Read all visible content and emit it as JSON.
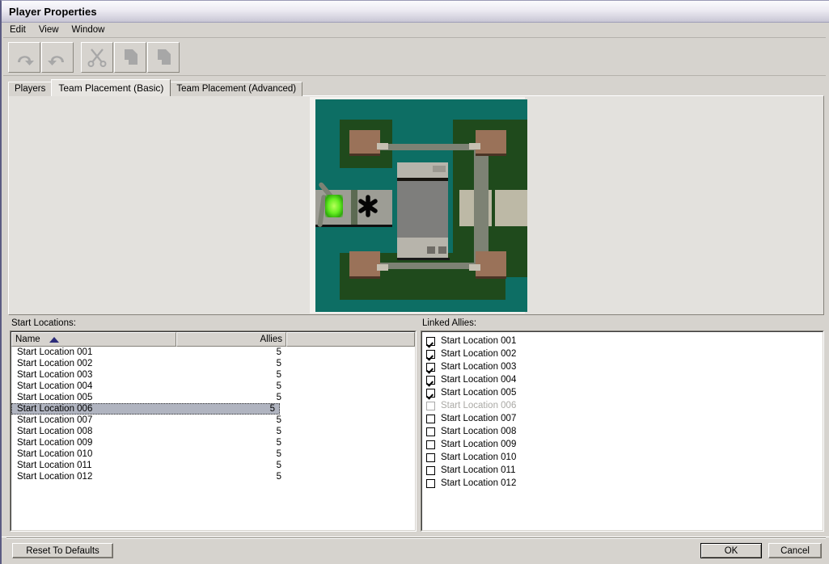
{
  "window": {
    "title": "Player Properties"
  },
  "menubar": {
    "items": [
      {
        "label": "Edit"
      },
      {
        "label": "View"
      },
      {
        "label": "Window"
      }
    ]
  },
  "toolbar": {
    "buttons": [
      {
        "name": "undo-button",
        "icon": "undo-icon",
        "label": "Undo"
      },
      {
        "name": "redo-button",
        "icon": "redo-icon",
        "label": "Redo"
      },
      {
        "name": "cut-button",
        "icon": "scissors-icon",
        "label": "Cut"
      },
      {
        "name": "copy-button",
        "icon": "copy-icon",
        "label": "Copy"
      },
      {
        "name": "paste-button",
        "icon": "paste-icon",
        "label": "Paste"
      }
    ]
  },
  "tabs": [
    {
      "label": "Players",
      "active": false
    },
    {
      "label": "Team Placement (Basic)",
      "active": true
    },
    {
      "label": "Team Placement (Advanced)",
      "active": false
    }
  ],
  "map_preview": {
    "background_color": "#0d6e64",
    "terrain_color": "#1f4a1c",
    "road_color": "#7d8274",
    "building_color": "#9a7259",
    "structure_color": "#7e7e7c",
    "concrete_color": "#9d9d95",
    "marker_color": "#66ee22"
  },
  "start_locations_panel": {
    "caption": "Start Locations:",
    "columns": [
      {
        "key": "name",
        "label": "Name",
        "sort": "asc"
      },
      {
        "key": "allies",
        "label": "Allies",
        "sort": "none"
      }
    ],
    "rows": [
      {
        "name": "Start Location 001",
        "allies": "5",
        "selected": false
      },
      {
        "name": "Start Location 002",
        "allies": "5",
        "selected": false
      },
      {
        "name": "Start Location 003",
        "allies": "5",
        "selected": false
      },
      {
        "name": "Start Location 004",
        "allies": "5",
        "selected": false
      },
      {
        "name": "Start Location 005",
        "allies": "5",
        "selected": false
      },
      {
        "name": "Start Location 006",
        "allies": "5",
        "selected": true
      },
      {
        "name": "Start Location 007",
        "allies": "5",
        "selected": false
      },
      {
        "name": "Start Location 008",
        "allies": "5",
        "selected": false
      },
      {
        "name": "Start Location 009",
        "allies": "5",
        "selected": false
      },
      {
        "name": "Start Location 010",
        "allies": "5",
        "selected": false
      },
      {
        "name": "Start Location 011",
        "allies": "5",
        "selected": false
      },
      {
        "name": "Start Location 012",
        "allies": "5",
        "selected": false
      }
    ]
  },
  "linked_allies_panel": {
    "caption": "Linked Allies:",
    "rows": [
      {
        "label": "Start Location 001",
        "checked": true,
        "disabled": false
      },
      {
        "label": "Start Location 002",
        "checked": true,
        "disabled": false
      },
      {
        "label": "Start Location 003",
        "checked": true,
        "disabled": false
      },
      {
        "label": "Start Location 004",
        "checked": true,
        "disabled": false
      },
      {
        "label": "Start Location 005",
        "checked": true,
        "disabled": false
      },
      {
        "label": "Start Location 006",
        "checked": false,
        "disabled": true
      },
      {
        "label": "Start Location 007",
        "checked": false,
        "disabled": false
      },
      {
        "label": "Start Location 008",
        "checked": false,
        "disabled": false
      },
      {
        "label": "Start Location 009",
        "checked": false,
        "disabled": false
      },
      {
        "label": "Start Location 010",
        "checked": false,
        "disabled": false
      },
      {
        "label": "Start Location 011",
        "checked": false,
        "disabled": false
      },
      {
        "label": "Start Location 012",
        "checked": false,
        "disabled": false
      }
    ]
  },
  "footer": {
    "reset_label": "Reset To Defaults",
    "ok_label": "OK",
    "cancel_label": "Cancel"
  }
}
